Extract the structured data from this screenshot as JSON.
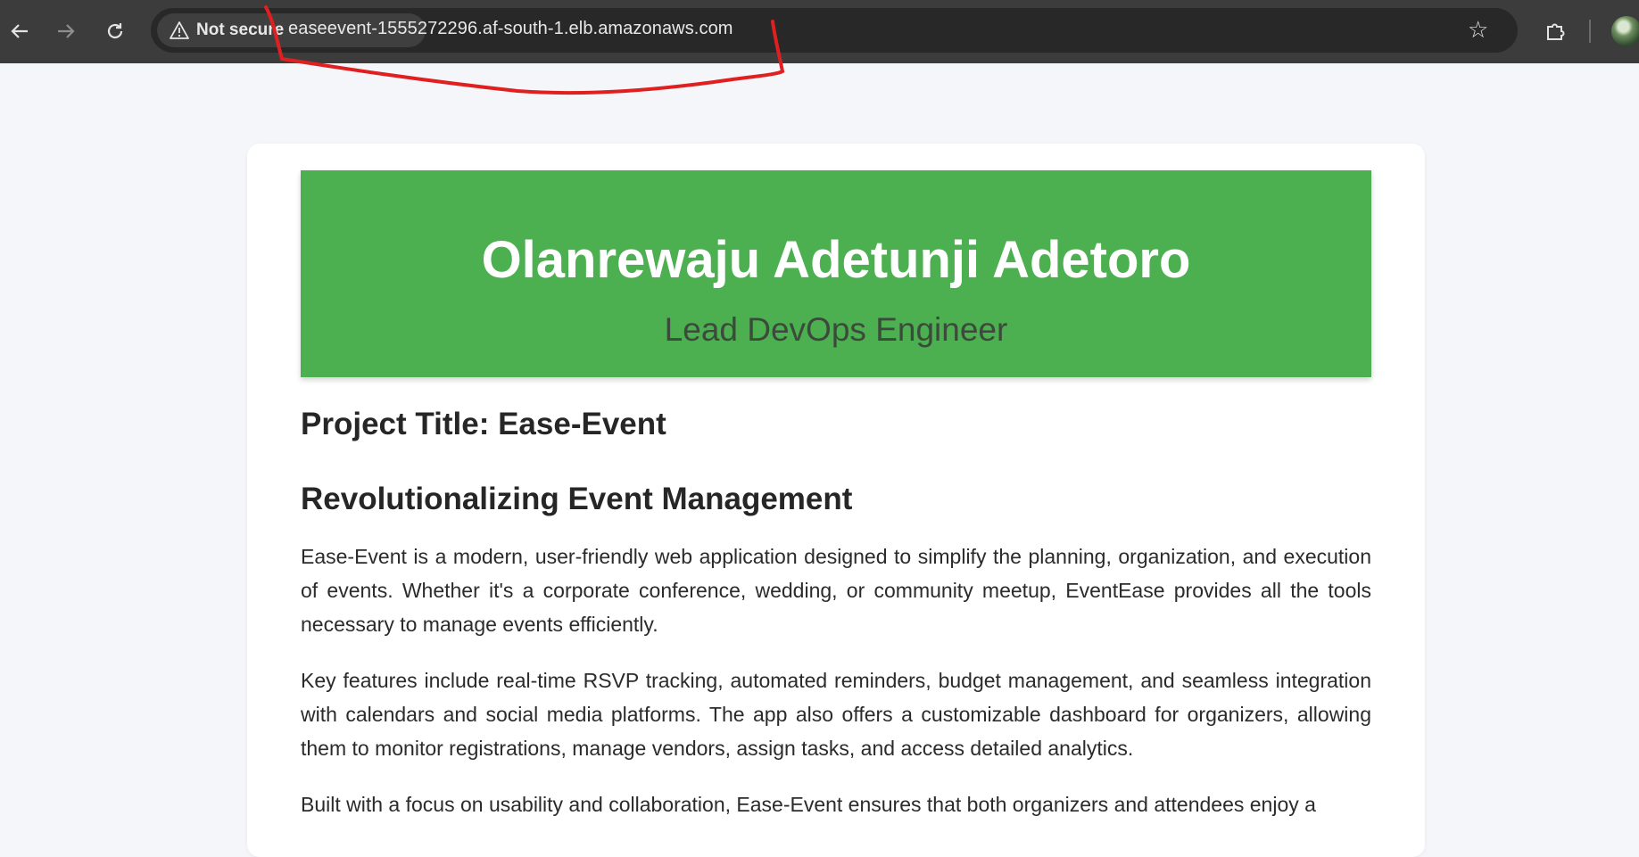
{
  "browser": {
    "security_label": "Not secure",
    "url": "easeevent-1555272296.af-south-1.elb.amazonaws.com",
    "icons": {
      "back": "arrow-left-icon",
      "forward": "arrow-right-icon",
      "reload": "reload-icon",
      "warning": "warning-triangle-icon",
      "bookmark": "star-icon",
      "extensions": "puzzle-icon",
      "profile": "avatar"
    }
  },
  "hero": {
    "name": "Olanrewaju Adetunji Adetoro",
    "role": "Lead DevOps Engineer",
    "background_color": "#4caf50"
  },
  "content": {
    "project_title": "Project Title: Ease-Event",
    "section_heading": "Revolutionalizing Event Management",
    "paragraphs": [
      "Ease-Event is a modern, user-friendly web application designed to simplify the planning, organization, and execution of events. Whether it's a corporate conference, wedding, or community meetup, EventEase provides all the tools necessary to manage events efficiently.",
      "Key features include real-time RSVP tracking, automated reminders, budget management, and seamless integration with calendars and social media platforms. The app also offers a customizable dashboard for organizers, allowing them to monitor registrations, manage vendors, assign tasks, and access detailed analytics.",
      "Built with a focus on usability and collaboration, Ease-Event ensures that both organizers and attendees enjoy a"
    ]
  },
  "annotation_color": "#e02020"
}
